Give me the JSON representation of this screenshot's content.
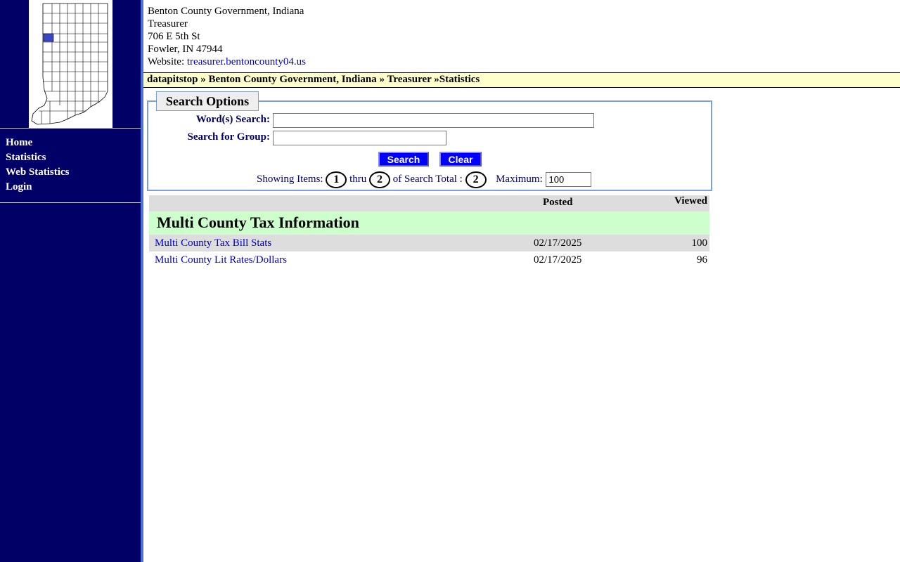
{
  "header": {
    "org": "Benton County Government, Indiana",
    "dept": "Treasurer",
    "address": "706 E 5th St",
    "city": "Fowler, IN 47944",
    "website_label": "Website:",
    "website": "treasurer.bentoncounty04.us"
  },
  "breadcrumb": {
    "part1": "datapitstop",
    "sep1": " » ",
    "part2": "Benton County Government, Indiana",
    "sep2": " » ",
    "part3": "Treasurer",
    "sep3": " »",
    "part4": "Statistics"
  },
  "sidebar": {
    "map_icon": "indiana-county-map",
    "items": [
      {
        "label": "Home"
      },
      {
        "label": "Statistics"
      },
      {
        "label": "Web Statistics"
      },
      {
        "label": "Login"
      }
    ]
  },
  "search": {
    "legend": "Search Options",
    "words_label": "Word(s) Search:",
    "words_value": "",
    "group_label": "Search for Group:",
    "group_value": "",
    "search_button": "Search",
    "clear_button": "Clear",
    "showing_label": "Showing Items:",
    "from": "1",
    "thru_label": "thru",
    "to": "2",
    "total_label": "of Search Total :",
    "total": "2",
    "max_label": "Maximum:",
    "max_value": "100"
  },
  "results": {
    "col_posted": "Posted",
    "col_viewed": "Viewed",
    "group": "Multi County Tax Information",
    "rows": [
      {
        "title": "Multi County Tax Bill Stats",
        "posted": "02/17/2025",
        "viewed": "100"
      },
      {
        "title": "Multi County Lit Rates/Dollars",
        "posted": "02/17/2025",
        "viewed": "96"
      }
    ]
  },
  "colors": {
    "sidebar_bg": "#000066",
    "breadcrumb_bg": "#ffffcc",
    "group_bg": "#ccffcc",
    "button_bg": "#0000ff",
    "link": "#0000cc"
  }
}
